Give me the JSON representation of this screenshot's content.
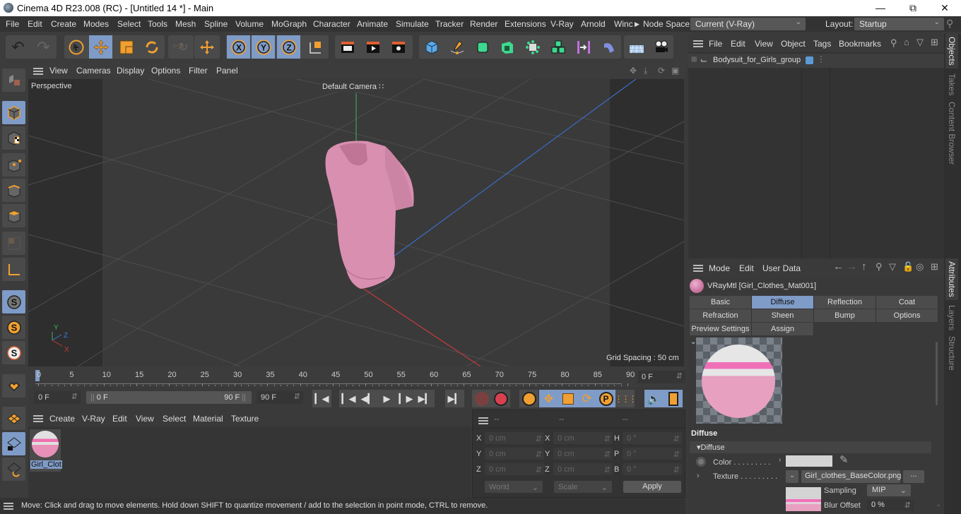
{
  "window": {
    "title": "Cinema 4D R23.008 (RC) - [Untitled 14 *] - Main",
    "controls": [
      "minimize",
      "maximize",
      "close"
    ]
  },
  "menubar": {
    "items": [
      "File",
      "Edit",
      "Create",
      "Modes",
      "Select",
      "Tools",
      "Mesh",
      "Spline",
      "Volume",
      "MoGraph",
      "Character",
      "Animate",
      "Simulate",
      "Tracker",
      "Render",
      "Extensions",
      "V-Ray",
      "Arnold",
      "Winc"
    ],
    "node_space_label": "Node Space:",
    "node_space_value": "Current (V-Ray)",
    "layout_label": "Layout:",
    "layout_value": "Startup"
  },
  "toolbar": {
    "tools": [
      "undo",
      "redo",
      "live-selection",
      "move",
      "scale",
      "rotate",
      "psr-reset",
      "move-recent",
      "x-axis-lock",
      "y-axis-lock",
      "z-axis-lock",
      "coordinate-system",
      "render-view",
      "render-picture-viewer",
      "render-settings",
      "cube",
      "pen",
      "subdivision-surface",
      "extrude",
      "symmetry-cloner",
      "cloner",
      "bend-deformer",
      "bend",
      "floor",
      "camera"
    ],
    "psr_label": "PSR"
  },
  "viewport": {
    "menu": [
      "View",
      "Cameras",
      "Display",
      "Options",
      "Filter",
      "Panel"
    ],
    "view_name": "Perspective",
    "camera_label": "Default Camera",
    "grid_spacing": "Grid Spacing : 50 cm",
    "axis_labels": {
      "y": "Y",
      "z": "Z",
      "x": "X"
    }
  },
  "timeline": {
    "ticks": [
      "0",
      "5",
      "10",
      "15",
      "20",
      "25",
      "30",
      "35",
      "40",
      "45",
      "50",
      "55",
      "60",
      "65",
      "70",
      "75",
      "80",
      "85",
      "90"
    ],
    "current_frame_field": "0 F",
    "start_field": "0 F",
    "range_start": "0 F",
    "range_end": "90 F",
    "end_field": "90 F"
  },
  "material_manager": {
    "menu": [
      "Create",
      "V-Ray",
      "Edit",
      "View",
      "Select",
      "Material",
      "Texture"
    ],
    "materials": [
      {
        "label": "Girl_Clot",
        "selected": true
      }
    ]
  },
  "coordinates": {
    "headers": [
      "--",
      "--",
      "--"
    ],
    "rows": [
      {
        "l1": "X",
        "v1": "0 cm",
        "l2": "X",
        "v2": "0 cm",
        "l3": "H",
        "v3": "0 °"
      },
      {
        "l1": "Y",
        "v1": "0 cm",
        "l2": "Y",
        "v2": "0 cm",
        "l3": "P",
        "v3": "0 °"
      },
      {
        "l1": "Z",
        "v1": "0 cm",
        "l2": "Z",
        "v2": "0 cm",
        "l3": "B",
        "v3": "0 °"
      }
    ],
    "space_select": "World",
    "mode_select": "Scale",
    "apply_label": "Apply"
  },
  "status": {
    "text": "Move: Click and drag to move elements. Hold down SHIFT to quantize movement / add to the selection in point mode, CTRL to remove."
  },
  "objects_panel": {
    "menu": [
      "File",
      "Edit",
      "View",
      "Object",
      "Tags",
      "Bookmarks"
    ],
    "items": [
      {
        "name": "Bodysuit_for_Girls_group",
        "layer_color": "#5b9bd5"
      }
    ]
  },
  "attributes_panel": {
    "menu": [
      "Mode",
      "Edit",
      "User Data"
    ],
    "material_title": "VRayMtl [Girl_Clothes_Mat001]",
    "tabs_row1": [
      "Basic",
      "Diffuse",
      "Reflection",
      "Coat"
    ],
    "tabs_row2": [
      "Refraction",
      "Sheen",
      "Bump",
      "Options"
    ],
    "tabs_row3": [
      "Preview Settings",
      "Assign"
    ],
    "active_tab": "Diffuse",
    "section_title": "Diffuse",
    "group_title": "Diffuse",
    "color_label": "Color . . . . . . . . .",
    "color_value": "#d4d4d4",
    "texture_label": "Texture . . . . . . . . .",
    "texture_file": "Girl_clothes_BaseColor.png",
    "texture_more": "...",
    "sampling_label": "Sampling",
    "sampling_value": "MIP",
    "blur_label": "Blur Offset",
    "blur_value": "0 %"
  },
  "side_tabs": {
    "top": [
      "Objects",
      "Takes",
      "Content Browser"
    ],
    "bottom": [
      "Attributes",
      "Layers",
      "Structure"
    ]
  },
  "colors": {
    "accent_selected": "#7f9bc7",
    "tool_orange": "#f0a030",
    "model_pink": "#e8a0c0"
  }
}
